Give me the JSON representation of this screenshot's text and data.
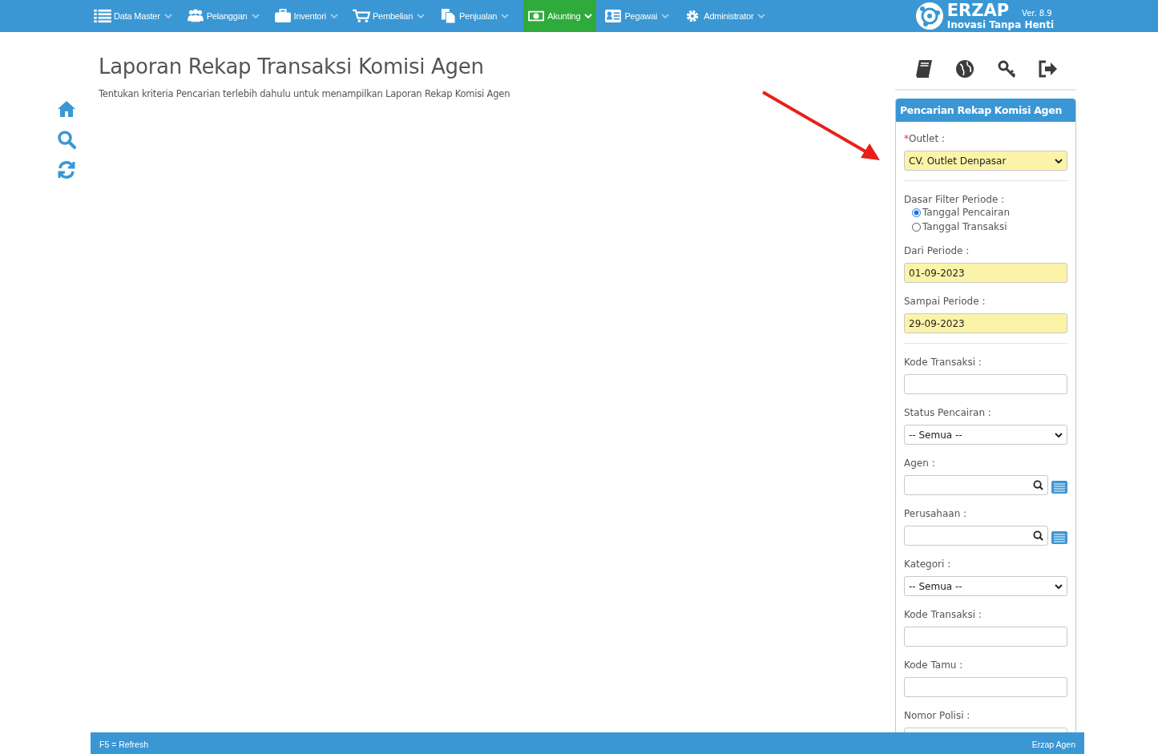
{
  "nav": {
    "items": [
      {
        "label": "Data Master",
        "selected": false
      },
      {
        "label": "Pelanggan",
        "selected": false
      },
      {
        "label": "Inventori",
        "selected": false
      },
      {
        "label": "Pembelian",
        "selected": false
      },
      {
        "label": "Penjualan",
        "selected": false
      },
      {
        "label": "Akunting",
        "selected": true
      },
      {
        "label": "Pegawai",
        "selected": false
      },
      {
        "label": "Administrator",
        "selected": false
      }
    ],
    "brand": {
      "name": "ERZAP",
      "version": "Ver. 8.9",
      "tagline": "Inovasi Tanpa Henti"
    }
  },
  "page": {
    "title": "Laporan Rekap Transaksi Komisi Agen",
    "subtitle": "Tentukan kriteria Pencarian terlebih dahulu untuk menampilkan Laporan Rekap Komisi Agen"
  },
  "panel": {
    "title": "Pencarian Rekap Komisi Agen",
    "fields": [
      {
        "kind": "select",
        "required_mark": "*",
        "label": "Outlet :",
        "value": "CV. Outlet Denpasar",
        "highlighted": true
      },
      {
        "kind": "divider"
      },
      {
        "kind": "radio",
        "label": "Dasar Filter Periode :",
        "options": [
          {
            "label": "Tanggal Pencairan",
            "selected": true
          },
          {
            "label": "Tanggal Transaksi",
            "selected": false
          }
        ]
      },
      {
        "kind": "text",
        "label": "Dari Periode :",
        "value": "01-09-2023",
        "highlighted": true
      },
      {
        "kind": "text",
        "label": "Sampai Periode :",
        "value": "29-09-2023",
        "highlighted": true
      },
      {
        "kind": "divider"
      },
      {
        "kind": "text",
        "label": "Kode Transaksi :",
        "highlighted": false
      },
      {
        "kind": "select",
        "label": "Status Pencairan :",
        "value": "-- Semua --",
        "highlighted": false
      },
      {
        "kind": "lookup",
        "label": "Agen :",
        "highlighted": false
      },
      {
        "kind": "lookup",
        "label": "Perusahaan :",
        "highlighted": false
      },
      {
        "kind": "select",
        "label": "Kategori :",
        "value": "-- Semua --",
        "highlighted": false
      },
      {
        "kind": "text",
        "label": "Kode Transaksi :",
        "highlighted": false
      },
      {
        "kind": "text",
        "label": "Kode Tamu :",
        "highlighted": false
      },
      {
        "kind": "text",
        "label": "Nomor Polisi :",
        "highlighted": false
      }
    ]
  },
  "status_bar": {
    "left": "F5 = Refresh",
    "right": "Erzap Agen"
  }
}
